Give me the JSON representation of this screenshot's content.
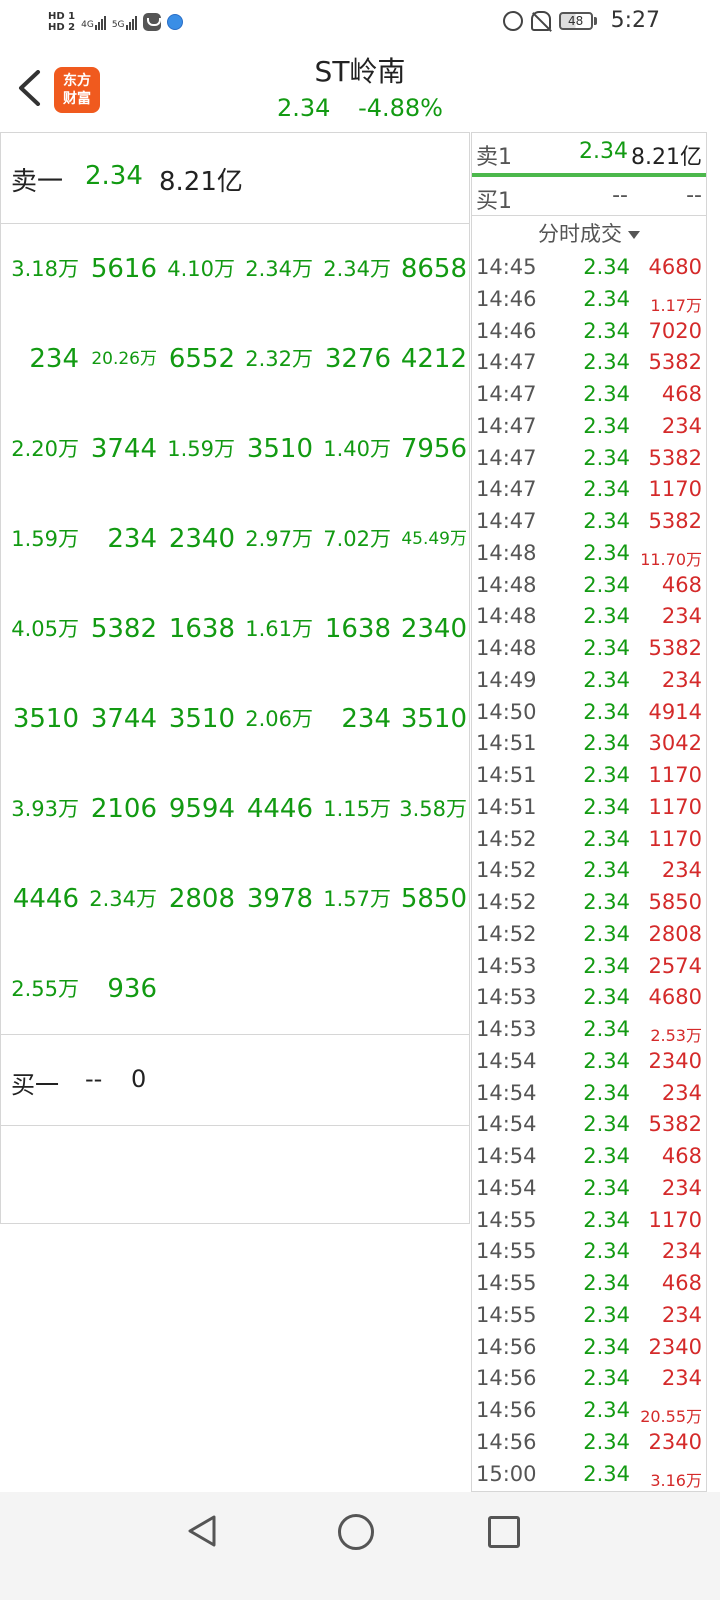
{
  "status_bar": {
    "sim1": "HD 1",
    "sim2": "HD 2",
    "net1": "4G",
    "net2": "5G",
    "battery": "48",
    "time": "5:27"
  },
  "header": {
    "logo_line1": "东方",
    "logo_line2": "财富",
    "title": "ST岭南",
    "price": "2.34",
    "change_pct": "-4.88%",
    "price_color": "#129a12"
  },
  "order_queue": {
    "sell_label": "卖一",
    "sell_price": "2.34",
    "sell_volume": "8.21亿",
    "rows": [
      [
        "3.18万",
        "5616",
        "4.10万",
        "2.34万",
        "2.34万",
        "8658"
      ],
      [
        "234",
        "20.26万",
        "6552",
        "2.32万",
        "3276",
        "4212"
      ],
      [
        "2.20万",
        "3744",
        "1.59万",
        "3510",
        "1.40万",
        "7956"
      ],
      [
        "1.59万",
        "234",
        "2340",
        "2.97万",
        "7.02万",
        "45.49万"
      ],
      [
        "4.05万",
        "5382",
        "1638",
        "1.61万",
        "1638",
        "2340"
      ],
      [
        "3510",
        "3744",
        "3510",
        "2.06万",
        "234",
        "3510"
      ],
      [
        "3.93万",
        "2106",
        "9594",
        "4446",
        "1.15万",
        "3.58万"
      ],
      [
        "4446",
        "2.34万",
        "2808",
        "3978",
        "1.57万",
        "5850"
      ],
      [
        "2.55万",
        "936"
      ]
    ],
    "buy_label": "买一",
    "buy_price": "--",
    "buy_volume": "0"
  },
  "quote_box": {
    "sell1_label": "卖1",
    "sell1_price": "2.34",
    "sell1_volume": "8.21亿",
    "buy1_label": "买1",
    "buy1_price": "--",
    "buy1_volume": "--"
  },
  "tape": {
    "header": "分时成交",
    "rows": [
      {
        "time": "14:45",
        "price": "2.34",
        "volume": "4680"
      },
      {
        "time": "14:46",
        "price": "2.34",
        "volume": "1.17万"
      },
      {
        "time": "14:46",
        "price": "2.34",
        "volume": "7020"
      },
      {
        "time": "14:47",
        "price": "2.34",
        "volume": "5382"
      },
      {
        "time": "14:47",
        "price": "2.34",
        "volume": "468"
      },
      {
        "time": "14:47",
        "price": "2.34",
        "volume": "234"
      },
      {
        "time": "14:47",
        "price": "2.34",
        "volume": "5382"
      },
      {
        "time": "14:47",
        "price": "2.34",
        "volume": "1170"
      },
      {
        "time": "14:47",
        "price": "2.34",
        "volume": "5382"
      },
      {
        "time": "14:48",
        "price": "2.34",
        "volume": "11.70万"
      },
      {
        "time": "14:48",
        "price": "2.34",
        "volume": "468"
      },
      {
        "time": "14:48",
        "price": "2.34",
        "volume": "234"
      },
      {
        "time": "14:48",
        "price": "2.34",
        "volume": "5382"
      },
      {
        "time": "14:49",
        "price": "2.34",
        "volume": "234"
      },
      {
        "time": "14:50",
        "price": "2.34",
        "volume": "4914"
      },
      {
        "time": "14:51",
        "price": "2.34",
        "volume": "3042"
      },
      {
        "time": "14:51",
        "price": "2.34",
        "volume": "1170"
      },
      {
        "time": "14:51",
        "price": "2.34",
        "volume": "1170"
      },
      {
        "time": "14:52",
        "price": "2.34",
        "volume": "1170"
      },
      {
        "time": "14:52",
        "price": "2.34",
        "volume": "234"
      },
      {
        "time": "14:52",
        "price": "2.34",
        "volume": "5850"
      },
      {
        "time": "14:52",
        "price": "2.34",
        "volume": "2808"
      },
      {
        "time": "14:53",
        "price": "2.34",
        "volume": "2574"
      },
      {
        "time": "14:53",
        "price": "2.34",
        "volume": "4680"
      },
      {
        "time": "14:53",
        "price": "2.34",
        "volume": "2.53万"
      },
      {
        "time": "14:54",
        "price": "2.34",
        "volume": "2340"
      },
      {
        "time": "14:54",
        "price": "2.34",
        "volume": "234"
      },
      {
        "time": "14:54",
        "price": "2.34",
        "volume": "5382"
      },
      {
        "time": "14:54",
        "price": "2.34",
        "volume": "468"
      },
      {
        "time": "14:54",
        "price": "2.34",
        "volume": "234"
      },
      {
        "time": "14:55",
        "price": "2.34",
        "volume": "1170"
      },
      {
        "time": "14:55",
        "price": "2.34",
        "volume": "234"
      },
      {
        "time": "14:55",
        "price": "2.34",
        "volume": "468"
      },
      {
        "time": "14:55",
        "price": "2.34",
        "volume": "234"
      },
      {
        "time": "14:56",
        "price": "2.34",
        "volume": "2340"
      },
      {
        "time": "14:56",
        "price": "2.34",
        "volume": "234"
      },
      {
        "time": "14:56",
        "price": "2.34",
        "volume": "20.55万"
      },
      {
        "time": "14:56",
        "price": "2.34",
        "volume": "2340"
      },
      {
        "time": "15:00",
        "price": "2.34",
        "volume": "3.16万"
      }
    ]
  },
  "colors": {
    "down_green": "#129a12",
    "volume_red": "#d42a2a",
    "logo_orange": "#f05a1e",
    "sell_underline": "#4cb84c"
  },
  "icons": {
    "back": "chevron-left-icon",
    "nav_back": "triangle-back-icon",
    "nav_home": "circle-home-icon",
    "nav_recent": "square-recent-icon",
    "alarm": "alarm-icon",
    "mute": "bell-off-icon"
  }
}
